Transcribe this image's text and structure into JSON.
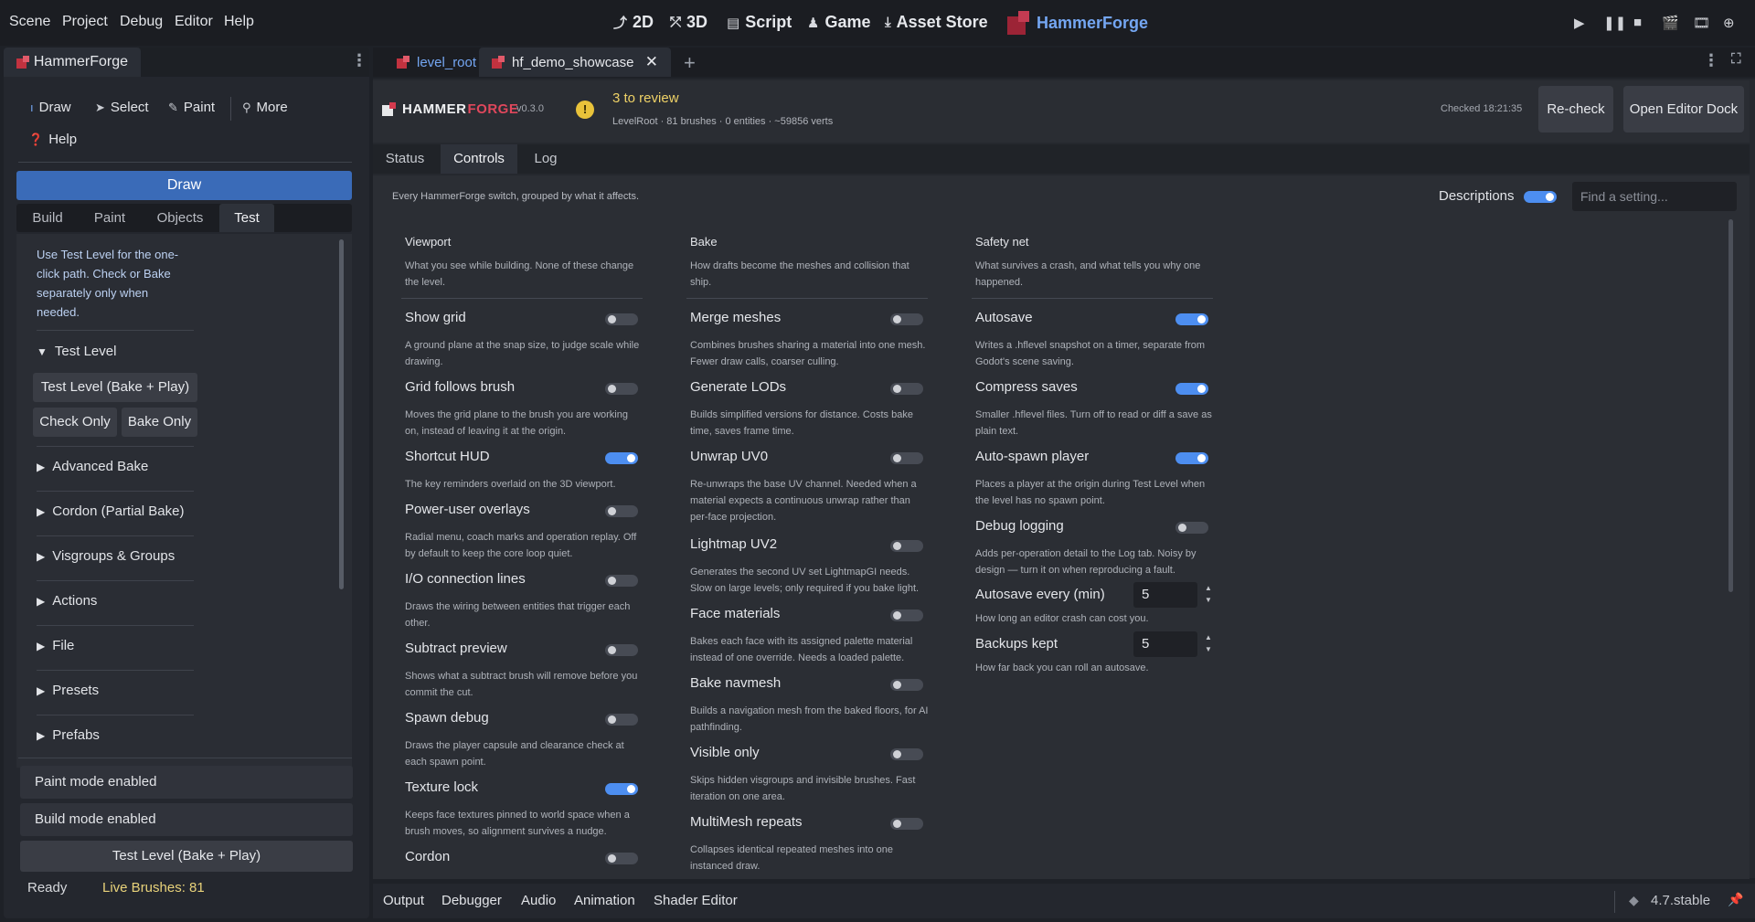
{
  "menu": [
    "Scene",
    "Project",
    "Debug",
    "Editor",
    "Help"
  ],
  "workspaces": {
    "w2d": "2D",
    "w3d": "3D",
    "script": "Script",
    "game": "Game",
    "asset_store": "Asset Store",
    "hammerforge": "HammerForge"
  },
  "left_dock": {
    "tab": "HammerForge",
    "tools": {
      "draw": "Draw",
      "select": "Select",
      "paint": "Paint",
      "more": "More",
      "help": "Help"
    },
    "mode_bar": "Draw",
    "sub_tabs": [
      "Build",
      "Paint",
      "Objects",
      "Test"
    ],
    "intro": "Use Test Level for the one-click path. Check or Bake separately only when needed.",
    "test_level_section": "Test Level",
    "test_level_button": "Test Level  (Bake + Play)",
    "check_only": "Check Only",
    "bake_only": "Bake Only",
    "sections": [
      "Advanced Bake",
      "Cordon (Partial Bake)",
      "Visgroups & Groups",
      "Actions",
      "File",
      "Presets",
      "Prefabs"
    ],
    "status_paint": "Paint mode enabled",
    "status_build": "Build mode enabled",
    "bottom_button": "Test Level  (Bake + Play)",
    "ready": "Ready",
    "live_brushes": "Live Brushes: 81"
  },
  "doc_tabs": {
    "level_root": "level_root",
    "showcase": "hf_demo_showcase",
    "close": "✕",
    "add": "+"
  },
  "header": {
    "brand_a": "HAMMER",
    "brand_b": "FORGE",
    "version": "v0.3.0",
    "review": "3 to review",
    "stats": "LevelRoot · 81 brushes · 0 entities · ~59856 verts",
    "checked": "Checked 18:21:35",
    "recheck": "Re-check",
    "open_dock": "Open Editor Dock"
  },
  "panel_tabs": [
    "Status",
    "Controls",
    "Log"
  ],
  "controls": {
    "intro": "Every HammerForge switch, grouped by what it affects.",
    "descriptions_label": "Descriptions",
    "descriptions_on": true,
    "find_placeholder": "Find a setting..."
  },
  "viewport": {
    "title": "Viewport",
    "desc": "What you see while building. None of these change the level.",
    "settings": [
      {
        "label": "Show grid",
        "desc": "A ground plane at the snap size, to judge scale while drawing.",
        "on": false
      },
      {
        "label": "Grid follows brush",
        "desc": "Moves the grid plane to the brush you are working on, instead of leaving it at the origin.",
        "on": false
      },
      {
        "label": "Shortcut HUD",
        "desc": "The key reminders overlaid on the 3D viewport.",
        "on": true
      },
      {
        "label": "Power-user overlays",
        "desc": "Radial menu, coach marks and operation replay. Off by default to keep the core loop quiet.",
        "on": false
      },
      {
        "label": "I/O connection lines",
        "desc": "Draws the wiring between entities that trigger each other.",
        "on": false
      },
      {
        "label": "Subtract preview",
        "desc": "Shows what a subtract brush will remove before you commit the cut.",
        "on": false
      },
      {
        "label": "Spawn debug",
        "desc": "Draws the player capsule and clearance check at each spawn point.",
        "on": false
      },
      {
        "label": "Texture lock",
        "desc": "Keeps face textures pinned to world space when a brush moves, so alignment survives a nudge.",
        "on": true
      },
      {
        "label": "Cordon",
        "desc": "",
        "on": false
      }
    ]
  },
  "bake": {
    "title": "Bake",
    "desc": "How drafts become the meshes and collision that ship.",
    "settings": [
      {
        "label": "Merge meshes",
        "desc": "Combines brushes sharing a material into one mesh. Fewer draw calls, coarser culling.",
        "on": false
      },
      {
        "label": "Generate LODs",
        "desc": "Builds simplified versions for distance. Costs bake time, saves frame time.",
        "on": false
      },
      {
        "label": "Unwrap UV0",
        "desc": "Re-unwraps the base UV channel. Needed when a material expects a continuous unwrap rather than per-face projection.",
        "on": false
      },
      {
        "label": "Lightmap UV2",
        "desc": "Generates the second UV set LightmapGI needs. Slow on large levels; only required if you bake light.",
        "on": false
      },
      {
        "label": "Face materials",
        "desc": "Bakes each face with its assigned palette material instead of one override. Needs a loaded palette.",
        "on": false
      },
      {
        "label": "Bake navmesh",
        "desc": "Builds a navigation mesh from the baked floors, for AI pathfinding.",
        "on": false
      },
      {
        "label": "Visible only",
        "desc": "Skips hidden visgroups and invisible brushes. Fast iteration on one area.",
        "on": false
      },
      {
        "label": "MultiMesh repeats",
        "desc": "Collapses identical repeated meshes into one instanced draw.",
        "on": false
      }
    ]
  },
  "safety": {
    "title": "Safety net",
    "desc": "What survives a crash, and what tells you why one happened.",
    "settings": [
      {
        "label": "Autosave",
        "desc": "Writes a .hflevel snapshot on a timer, separate from Godot's scene saving.",
        "on": true
      },
      {
        "label": "Compress saves",
        "desc": "Smaller .hflevel files. Turn off to read or diff a save as plain text.",
        "on": true
      },
      {
        "label": "Auto-spawn player",
        "desc": "Places a player at the origin during Test Level when the level has no spawn point.",
        "on": true
      },
      {
        "label": "Debug logging",
        "desc": "Adds per-operation detail to the Log tab. Noisy by design — turn it on when reproducing a fault.",
        "on": false
      }
    ],
    "autosave_every": {
      "label": "Autosave every (min)",
      "value": "5",
      "desc": "How long an editor crash can cost you."
    },
    "backups_kept": {
      "label": "Backups kept",
      "value": "5",
      "desc": "How far back you can roll an autosave."
    }
  },
  "bottom_tabs": [
    "Output",
    "Debugger",
    "Audio",
    "Animation",
    "Shader Editor"
  ],
  "engine_version": "4.7.stable",
  "colors": {
    "accent": "#4d8ef0",
    "brand_red": "#c43b52",
    "warning": "#e8c23a",
    "live_brushes": "#e8d27a"
  }
}
